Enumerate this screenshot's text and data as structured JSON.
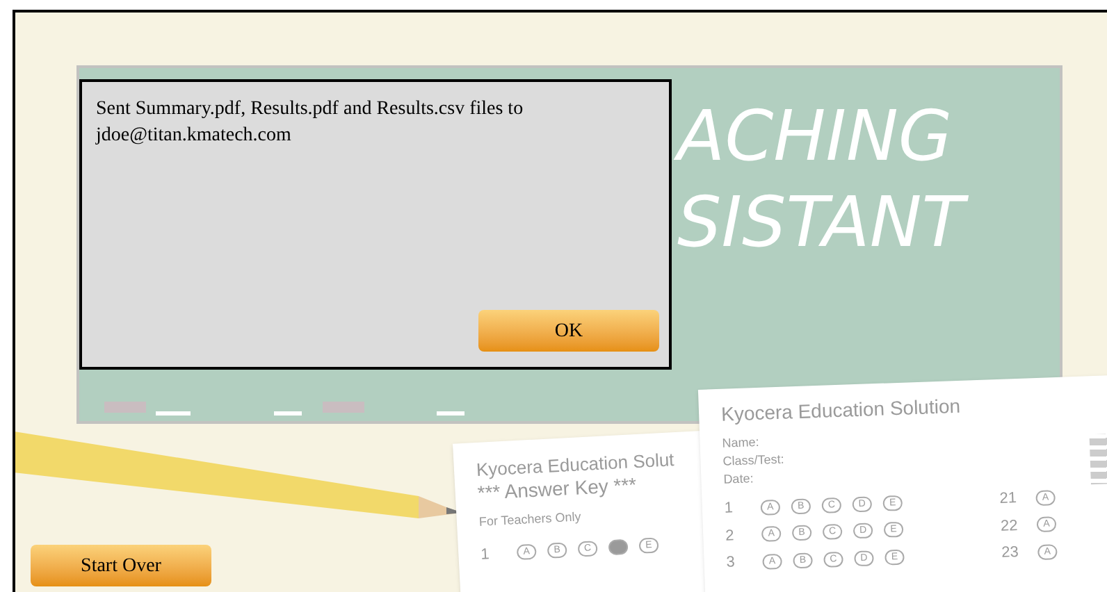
{
  "banner": {
    "lines": [
      "ACHING",
      "SISTANT"
    ]
  },
  "dialog": {
    "message": "Sent Summary.pdf, Results.pdf and Results.csv files to jdoe@titan.kmatech.com",
    "ok_button": "OK"
  },
  "answer_key_sheet": {
    "title": "Kyocera Education Solut",
    "subtitle": "*** Answer Key ***",
    "note": "For Teachers Only",
    "rows": [
      {
        "number": "1",
        "bubbles": [
          {
            "letter": "A",
            "filled": false
          },
          {
            "letter": "B",
            "filled": false
          },
          {
            "letter": "C",
            "filled": false
          },
          {
            "filled": true
          },
          {
            "letter": "E",
            "filled": false
          }
        ]
      }
    ]
  },
  "answer_sheet": {
    "title": "Kyocera Education Solution",
    "fields": [
      "Name:",
      "Class/Test:",
      "Date:"
    ],
    "rows": [
      {
        "number": "1",
        "bubbles": [
          {
            "letter": "A",
            "filled": false
          },
          {
            "letter": "B",
            "filled": false
          },
          {
            "letter": "C",
            "filled": false
          },
          {
            "letter": "D",
            "filled": false
          },
          {
            "letter": "E",
            "filled": false
          }
        ]
      },
      {
        "number": "2",
        "bubbles": [
          {
            "letter": "A",
            "filled": false
          },
          {
            "letter": "B",
            "filled": false
          },
          {
            "letter": "C",
            "filled": false
          },
          {
            "letter": "D",
            "filled": false
          },
          {
            "letter": "E",
            "filled": false
          }
        ]
      },
      {
        "number": "3",
        "bubbles": [
          {
            "letter": "A",
            "filled": false
          },
          {
            "letter": "B",
            "filled": false
          },
          {
            "letter": "C",
            "filled": false
          },
          {
            "letter": "D",
            "filled": false
          },
          {
            "letter": "E",
            "filled": false
          }
        ]
      }
    ],
    "rows_right": [
      {
        "number": "21",
        "bubbles": [
          {
            "letter": "A",
            "filled": false
          }
        ]
      },
      {
        "number": "22",
        "bubbles": [
          {
            "letter": "A",
            "filled": false
          }
        ]
      },
      {
        "number": "23",
        "bubbles": [
          {
            "letter": "A",
            "filled": false
          }
        ]
      }
    ]
  },
  "start_over_button": "Start Over"
}
